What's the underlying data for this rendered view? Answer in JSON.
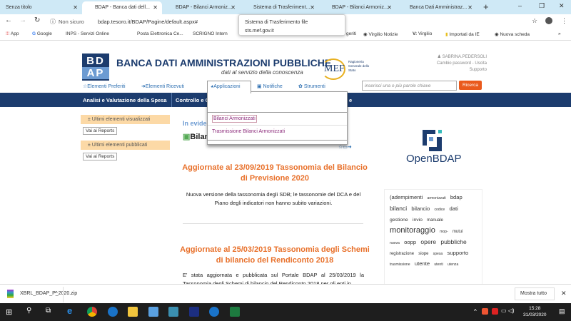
{
  "browser": {
    "tabs": [
      {
        "label": "Senza titolo"
      },
      {
        "label": "BDAP - Banca dati dell..."
      },
      {
        "label": "BDAP - Bilanci Armoniz..."
      },
      {
        "label": "Sistema di Trasferiment..."
      },
      {
        "label": "BDAP - Bilanci Armoniz..."
      },
      {
        "label": "Banca Dati Amministraz..."
      }
    ],
    "security": "Non sicuro",
    "url": "bdap.tesoro.it/BDAP/Pagine/default.aspx#",
    "tooltip": {
      "title": "Sistema di Trasferimento file",
      "url": "sts.mef.gov.it"
    },
    "bookmarks": [
      "App",
      "Google",
      "INPS - Servizi Online",
      "Posta Elettronica Ce...",
      "SCRIGNO Intern",
      "geriti",
      "Virgilio Notizie",
      "Virgilio",
      "Importati da IE",
      "Nuova scheda"
    ]
  },
  "header": {
    "logo_top": "BD",
    "logo_bottom": "AP",
    "title": "BANCA DATI AMMINISTRAZIONI PUBBLICHE",
    "subtitle": "dati al servizio della conoscenza",
    "mef": "MEF",
    "rgs": "Ragioneria Generale dello Stato",
    "user": "SABRINA.PEDERSOLI",
    "account_links": "Cambio password - Uscita",
    "support": "Supporto"
  },
  "toolbar": {
    "preferiti": "Elementi Preferiti",
    "ricevuti": "Elementi Ricevuti",
    "applicazioni": "Applicazioni",
    "notifiche": "Notifiche",
    "strumenti": "Strumenti",
    "search_placeholder": "inserisci una o più parole chiave",
    "search_button": "Ricerca"
  },
  "nav": {
    "items": [
      "Analisi e Valutazione della Spesa",
      "Controllo e C",
      "e"
    ]
  },
  "dropdown": {
    "items": [
      "Bilanci Armonizzati",
      "Trasmissione Bilanci Armonizzati"
    ]
  },
  "sidebar": {
    "visualizzati": "Ultimi elementi visualizzati",
    "pubblicati": "Ultimi elementi pubblicati",
    "reports": "Vai ai Reports"
  },
  "main": {
    "in_evidenza": "In evide",
    "section": "Bilan",
    "articles": [
      {
        "title": "Aggiornate al 23/09/2019 Tassonomia del Bilancio di Previsione 2020",
        "body": "Nuova versione della tassonomia degli SDB; le tassonomie del DCA e del Piano degli indicatori non hanno subito variazioni."
      },
      {
        "title": "Aggiornate al 25/03/2019 Tassonomia degli Schemi di bilancio del Rendiconto 2018",
        "body": "E' stata aggiornata e pubblicata sul Portale BDAP al 25/03/2019 la Tassonomia degli Schemi di bilancio del Rendiconto 2018 per gli enti in"
      }
    ]
  },
  "openbdap": "OpenBDAP",
  "tags": [
    [
      "(adempimenti",
      9
    ],
    [
      "armonizzati",
      6
    ],
    [
      "bdap",
      9
    ],
    [
      "bilanci",
      10
    ],
    [
      "bilancio",
      9
    ],
    [
      "codice",
      6
    ],
    [
      "dati",
      9
    ],
    [
      "gestione",
      8
    ],
    [
      "invio",
      8
    ],
    [
      "manuale",
      7
    ],
    [
      "monitoraggio",
      13
    ],
    [
      "mop-",
      6
    ],
    [
      "mutui",
      7
    ],
    [
      "nuova",
      6
    ],
    [
      "oopp",
      9
    ],
    [
      "opere",
      10
    ],
    [
      "pubbliche",
      10
    ],
    [
      "registrazione",
      7
    ],
    [
      "siope",
      7
    ],
    [
      "spesa",
      6
    ],
    [
      "supporto",
      9
    ],
    [
      "trasmissione",
      6
    ],
    [
      "utente",
      9
    ],
    [
      "utenti",
      6
    ],
    [
      "utenza",
      6
    ]
  ],
  "downloads": {
    "file": "XBRL_BDAP_P_2020.zip",
    "show_all": "Mostra tutto"
  },
  "taskbar": {
    "time": "15:28",
    "date": "31/03/2020"
  },
  "colors": {
    "nav": "#1c3c6e",
    "orange": "#e8702a",
    "tab_bg": "#cfe9f6"
  }
}
